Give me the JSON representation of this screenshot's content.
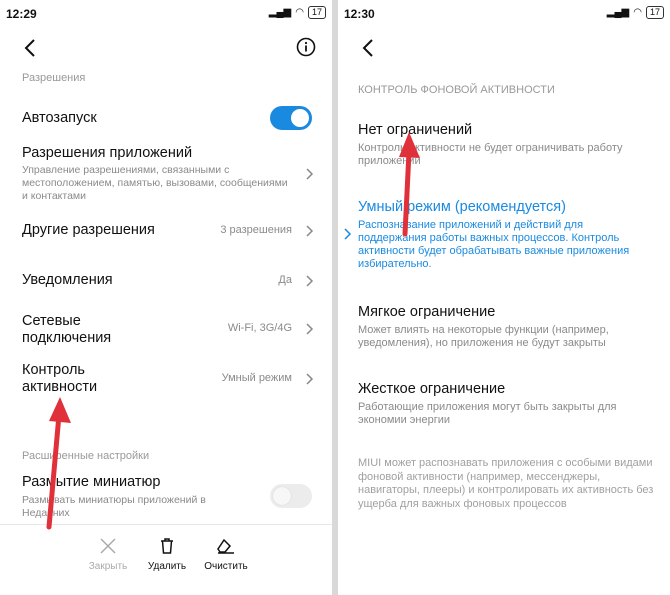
{
  "left": {
    "status": {
      "time": "12:29",
      "battery": "17"
    },
    "section_permissions": "Разрешения",
    "autostart": {
      "title": "Автозапуск",
      "enabled": true,
      "accent": "#1a8ae0"
    },
    "app_permissions": {
      "title": "Разрешения приложений",
      "subtitle": "Управление разрешениями, связанными с местоположением, памятью, вызовами, сообщениями и контактами"
    },
    "other_permissions": {
      "title": "Другие разрешения",
      "value": "3 разрешения"
    },
    "notifications": {
      "title": "Уведомления",
      "value": "Да"
    },
    "network": {
      "title": "Сетевые подключения",
      "value": "Wi-Fi, 3G/4G"
    },
    "activity_control": {
      "title": "Контроль активности",
      "value": "Умный режим"
    },
    "section_advanced": "Расширенные настройки",
    "blur_thumbnails": {
      "title": "Размытие миниатюр",
      "subtitle": "Размывать миниатюры приложений в Недавних",
      "enabled": false
    },
    "bottom": {
      "close": "Закрыть",
      "delete": "Удалить",
      "clear": "Очистить"
    }
  },
  "right": {
    "status": {
      "time": "12:30",
      "battery": "17"
    },
    "section": "КОНТРОЛЬ ФОНОВОЙ АКТИВНОСТИ",
    "options": [
      {
        "title": "Нет ограничений",
        "subtitle": "Контроль активности не будет ограничивать работу приложений"
      },
      {
        "title": "Умный режим (рекомендуется)",
        "subtitle": "Распознавание приложений и действий для поддержания работы важных процессов. Контроль активности будет обрабатывать важные приложения избирательно.",
        "selected": true
      },
      {
        "title": "Мягкое ограничение",
        "subtitle": "Может влиять на некоторые функции (например, уведомления), но приложения не будут закрыты"
      },
      {
        "title": "Жесткое ограничение",
        "subtitle": "Работающие приложения могут быть закрыты для экономии энергии"
      }
    ],
    "note": "MIUI может распознавать приложения с особыми видами фоновой активности (например, мессенджеры, навигаторы, плееры) и контролировать их активность без ущерба для важных фоновых процессов"
  },
  "colors": {
    "accent": "#1a8ae0",
    "arrow": "#e0303a"
  }
}
